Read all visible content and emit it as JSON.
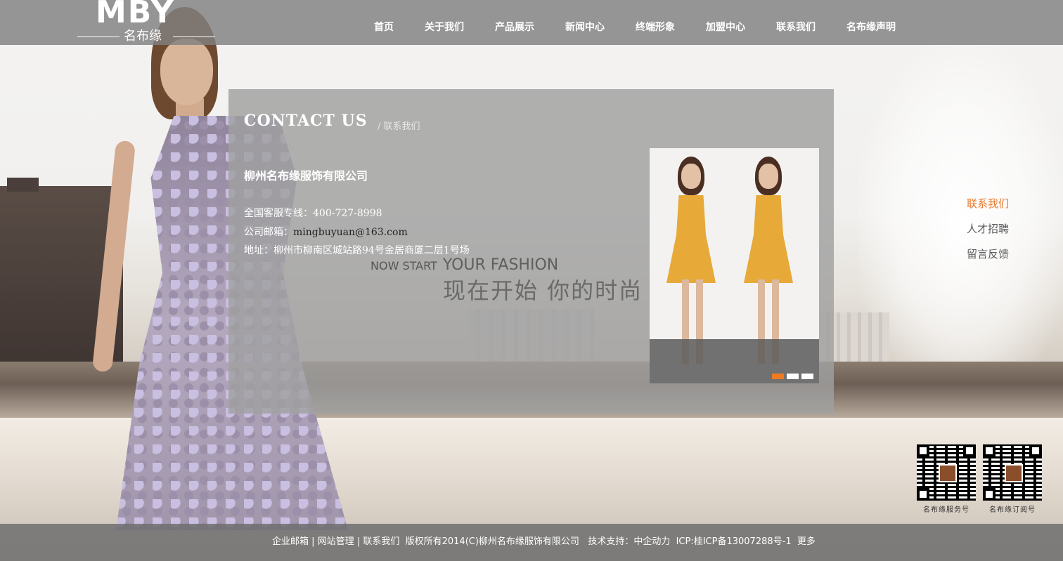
{
  "header": {
    "logo_mark": "MBY",
    "logo_name": "名布缘",
    "nav": [
      "首页",
      "关于我们",
      "产品展示",
      "新闻中心",
      "终端形象",
      "加盟中心",
      "联系我们",
      "名布缘声明"
    ]
  },
  "contact": {
    "title": "CONTACT US",
    "subtitle": "/ 联系我们",
    "company": "柳州名布缘服饰有限公司",
    "phone_label": "全国客服专线：",
    "phone": "400-727-8998",
    "email_label": "公司邮箱：",
    "email": "mingbuyuan@163.com",
    "address_label": "地址：",
    "address": "柳州市柳南区城站路94号金居商厦二层1号场"
  },
  "slogan": {
    "en_small": "NOW START",
    "en_big": "YOUR FASHION",
    "cn": "现在开始 你的时尚"
  },
  "slider": {
    "dots": 3,
    "active_index": 0
  },
  "side_menu": {
    "items": [
      "联系我们",
      "人才招聘",
      "留言反馈"
    ],
    "active_index": 0
  },
  "qr_codes": [
    {
      "label": "名布缘服务号"
    },
    {
      "label": "名布缘订阅号"
    }
  ],
  "footer": {
    "email_link": "企业邮箱",
    "sep1": " | ",
    "admin_link": "网站管理",
    "sep2": " | ",
    "contact_link": "联系我们",
    "copyright": "  版权所有2014(C)柳州名布缘服饰有限公司   技术支持：中企动力  ICP:桂ICP备13007288号-1  ",
    "more_link": "更多"
  },
  "colors": {
    "accent": "#ef7a22",
    "side_active": "#e87426",
    "header_bg": "#808080"
  }
}
